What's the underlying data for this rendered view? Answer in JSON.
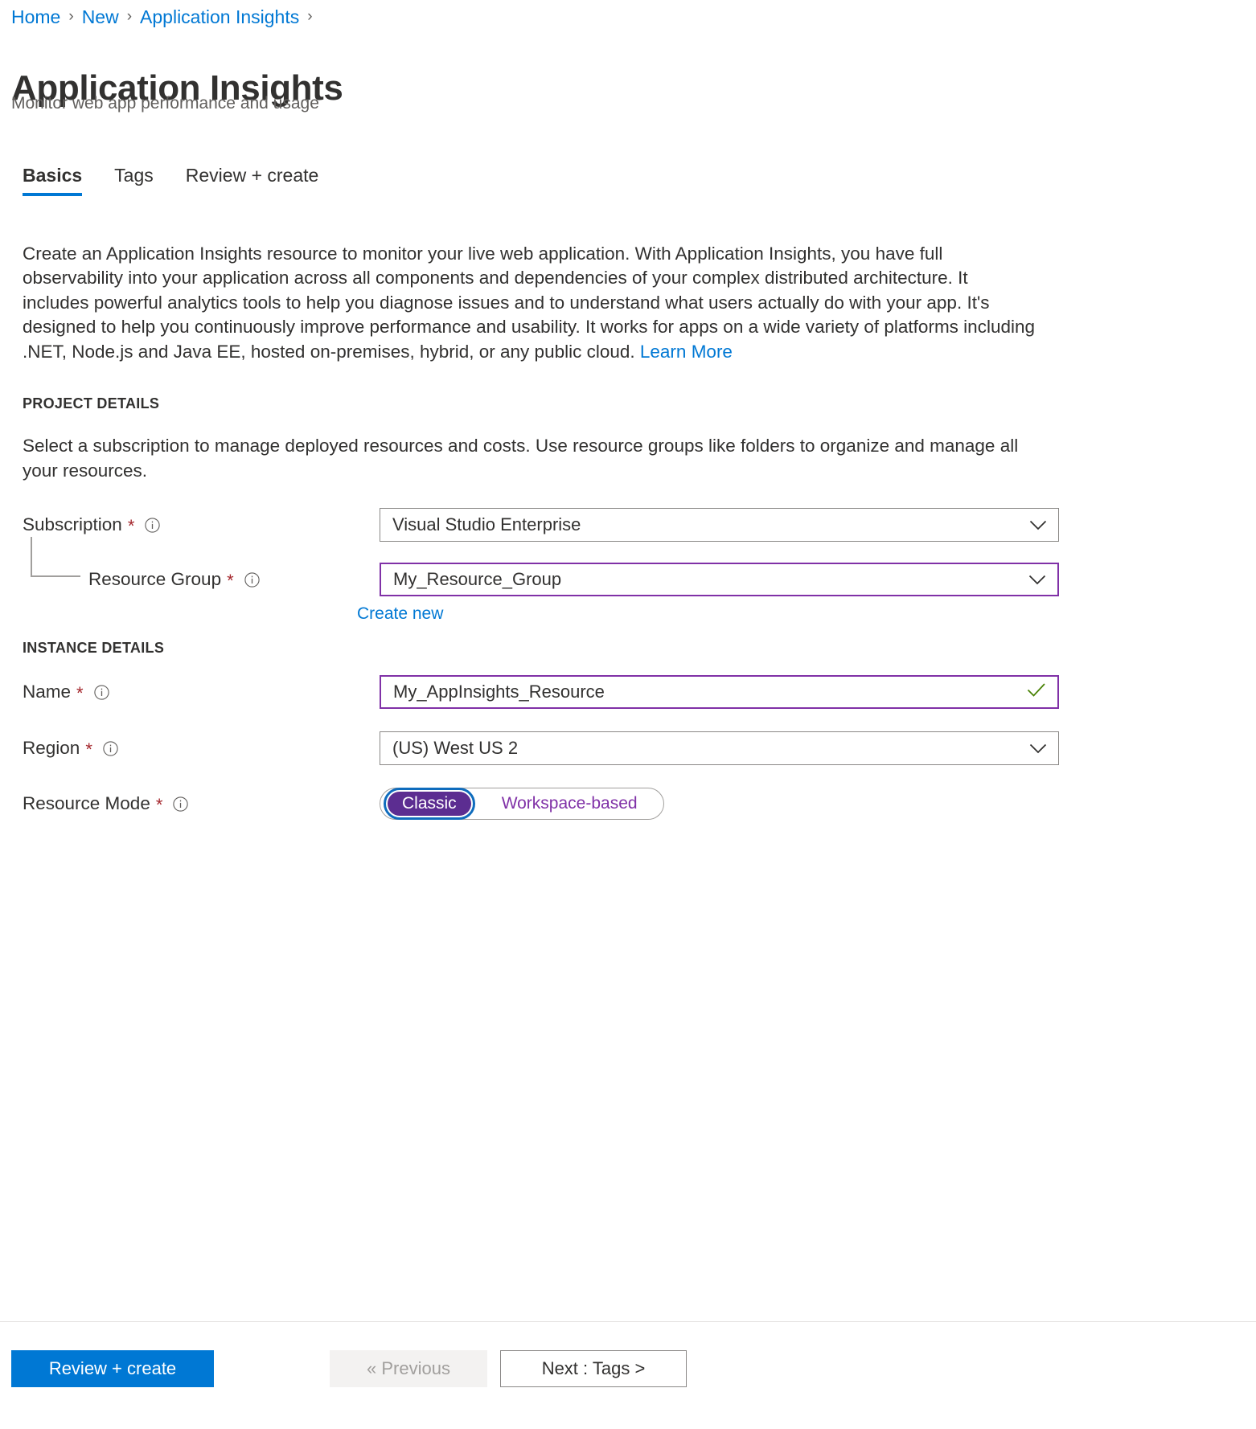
{
  "breadcrumb": {
    "items": [
      {
        "label": "Home"
      },
      {
        "label": "New"
      },
      {
        "label": "Application Insights"
      }
    ],
    "separator": "›"
  },
  "header": {
    "title": "Application Insights",
    "subtitle": "Monitor web app performance and usage"
  },
  "tabs": [
    {
      "label": "Basics",
      "active": true
    },
    {
      "label": "Tags",
      "active": false
    },
    {
      "label": "Review + create",
      "active": false
    }
  ],
  "intro": {
    "text": "Create an Application Insights resource to monitor your live web application. With Application Insights, you have full observability into your application across all components and dependencies of your complex distributed architecture. It includes powerful analytics tools to help you diagnose issues and to understand what users actually do with your app. It's designed to help you continuously improve performance and usability. It works for apps on a wide variety of platforms including .NET, Node.js and Java EE, hosted on-premises, hybrid, or any public cloud. ",
    "link_label": "Learn More"
  },
  "project_details": {
    "heading": "PROJECT DETAILS",
    "description": "Select a subscription to manage deployed resources and costs. Use resource groups like folders to organize and manage all your resources.",
    "subscription": {
      "label": "Subscription",
      "required_marker": "*",
      "value": "Visual Studio Enterprise"
    },
    "resource_group": {
      "label": "Resource Group",
      "required_marker": "*",
      "value": "My_Resource_Group",
      "create_new_label": "Create new"
    }
  },
  "instance_details": {
    "heading": "INSTANCE DETAILS",
    "name": {
      "label": "Name",
      "required_marker": "*",
      "value": "My_AppInsights_Resource"
    },
    "region": {
      "label": "Region",
      "required_marker": "*",
      "value": "(US) West US 2"
    },
    "resource_mode": {
      "label": "Resource Mode",
      "required_marker": "*",
      "options": [
        {
          "label": "Classic",
          "selected": true
        },
        {
          "label": "Workspace-based",
          "selected": false
        }
      ]
    }
  },
  "footer": {
    "review_create_label": "Review + create",
    "previous_label": "« Previous",
    "next_label": "Next : Tags >"
  },
  "colors": {
    "link": "#0078d4",
    "accent_purple": "#8031a7",
    "selected_pill": "#5c2d91",
    "required_star": "#a4262c",
    "valid_check": "#498205",
    "tab_underline": "#0078d4"
  }
}
